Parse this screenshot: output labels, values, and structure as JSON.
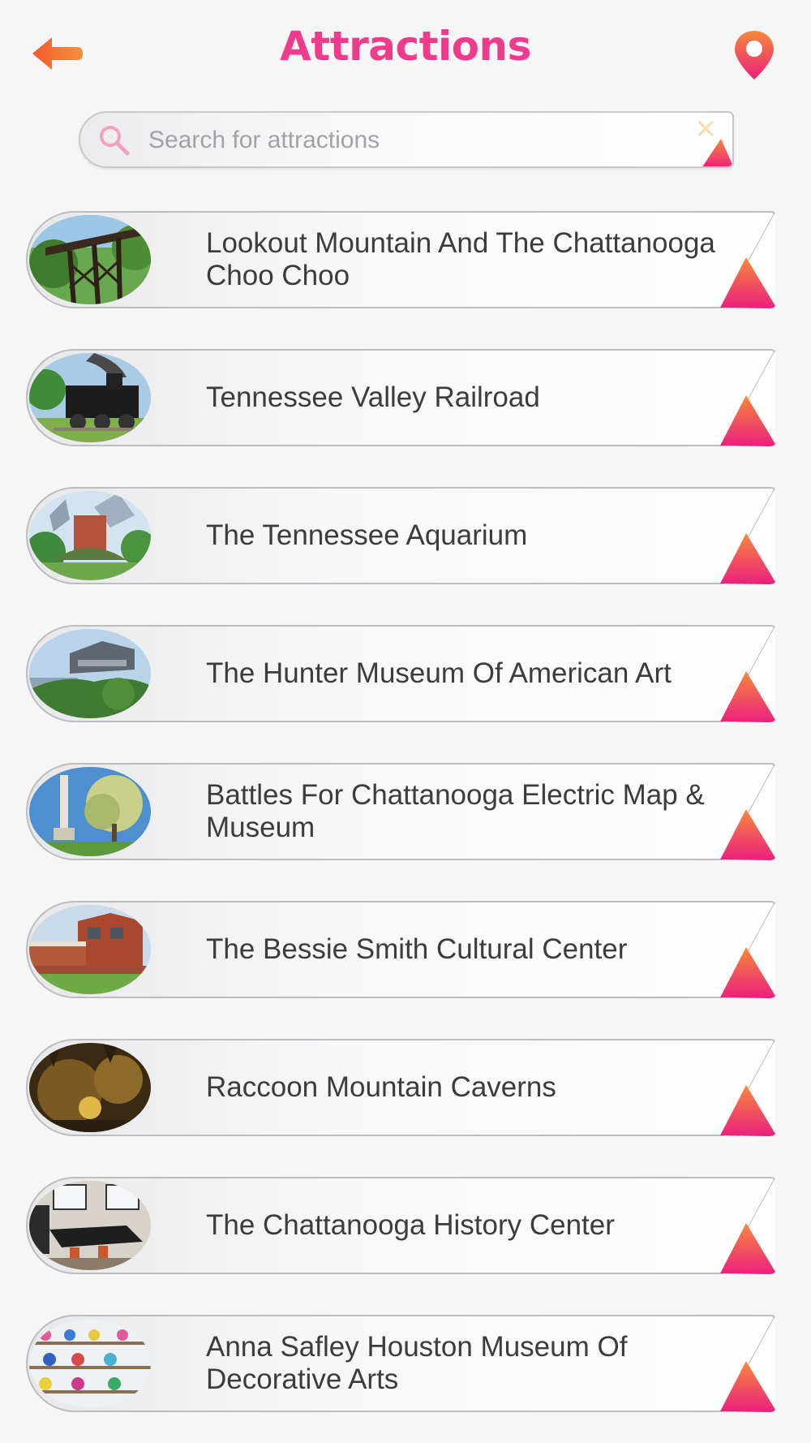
{
  "header": {
    "title": "Attractions",
    "back_icon": "back-arrow-icon",
    "map_icon": "map-pin-icon",
    "accent_color": "#ee3b8c",
    "back_color": "#f56a3a"
  },
  "search": {
    "placeholder": "Search for attractions",
    "value": "",
    "search_icon": "search-icon",
    "clear_icon": "close-icon"
  },
  "attractions": [
    {
      "name": "Lookout Mountain And The Chattanooga Choo Choo",
      "thumb": "trestle-bridge"
    },
    {
      "name": "Tennessee Valley Railroad",
      "thumb": "steam-locomotive"
    },
    {
      "name": "The Tennessee Aquarium",
      "thumb": "aquarium-building"
    },
    {
      "name": "The Hunter Museum Of American Art",
      "thumb": "museum-on-bluff"
    },
    {
      "name": "Battles For Chattanooga Electric Map & Museum",
      "thumb": "monument-and-tree"
    },
    {
      "name": "The Bessie Smith Cultural Center",
      "thumb": "brick-building"
    },
    {
      "name": "Raccoon Mountain Caverns",
      "thumb": "cave-interior"
    },
    {
      "name": "The Chattanooga History Center",
      "thumb": "office-interior"
    },
    {
      "name": "Anna Safley Houston Museum Of Decorative Arts",
      "thumb": "glass-shelves"
    }
  ],
  "colors": {
    "triangle_top": "#f7893a",
    "triangle_bottom": "#ec1f7e",
    "card_border": "#bdbdc1"
  }
}
